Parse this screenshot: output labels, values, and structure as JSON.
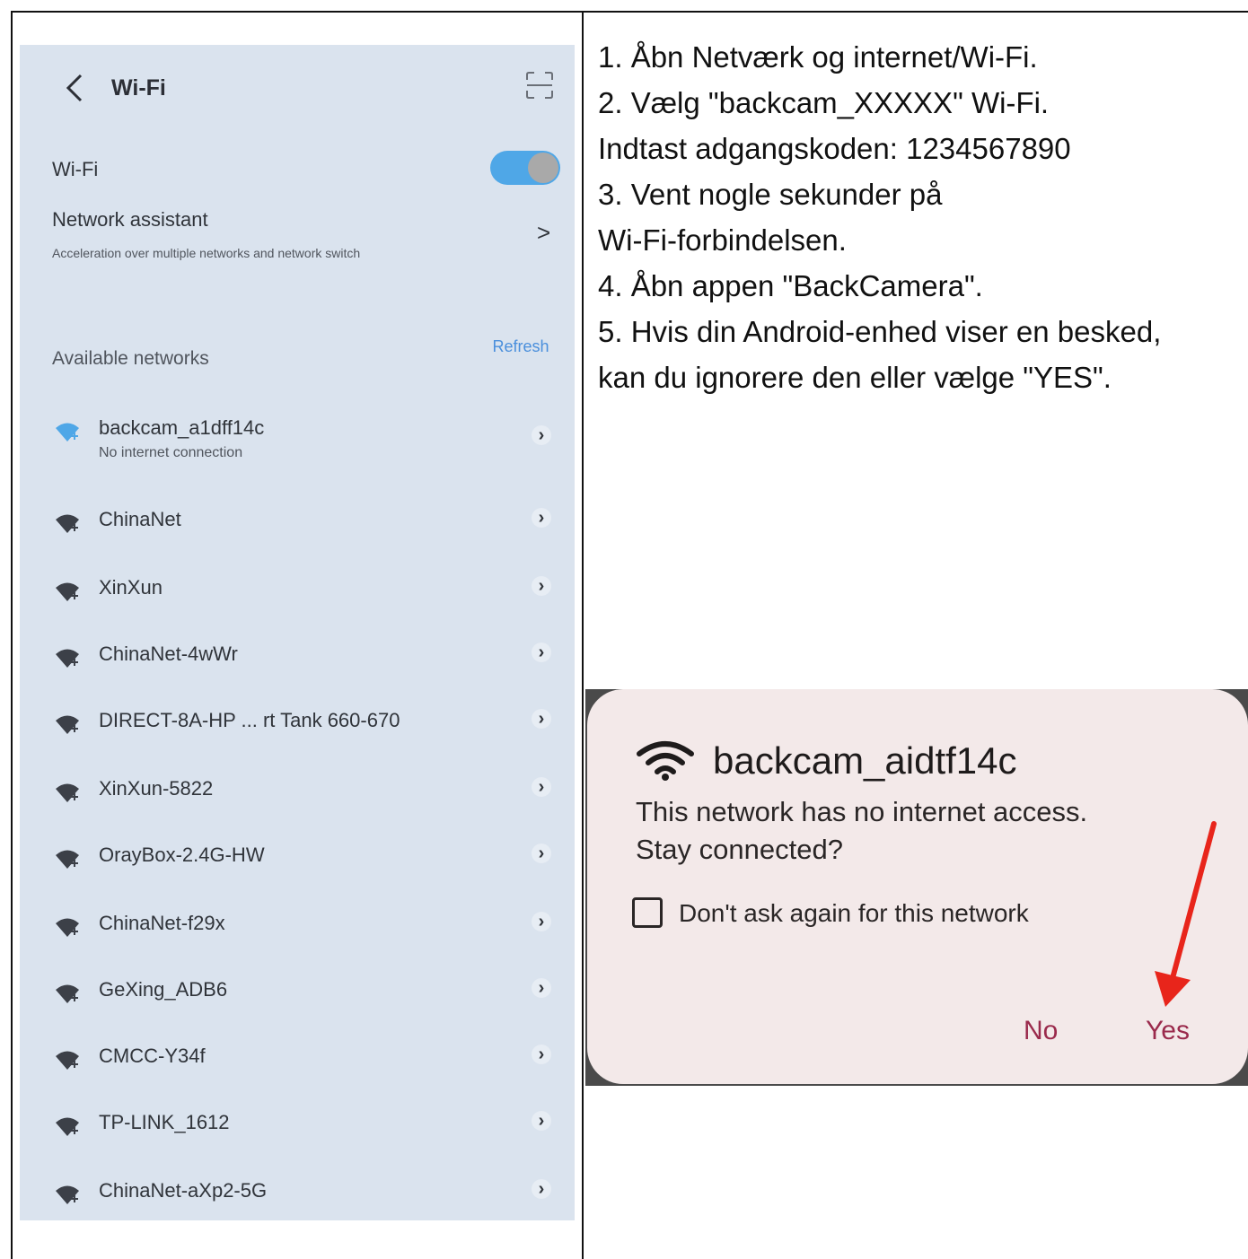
{
  "phone": {
    "title": "Wi-Fi",
    "wifi_label": "Wi-Fi",
    "wifi_enabled": true,
    "assistant_title": "Network assistant",
    "assistant_subtitle": "Acceleration over multiple networks and network switch",
    "available_label": "Available networks",
    "refresh_label": "Refresh",
    "networks": [
      {
        "name": "backcam_a1dff14c",
        "status": "No internet connection",
        "connected": true
      },
      {
        "name": "ChinaNet"
      },
      {
        "name": "XinXun"
      },
      {
        "name": "ChinaNet-4wWr"
      },
      {
        "name": "DIRECT-8A-HP ... rt Tank 660-670"
      },
      {
        "name": "XinXun-5822"
      },
      {
        "name": "OrayBox-2.4G-HW"
      },
      {
        "name": "ChinaNet-f29x"
      },
      {
        "name": "GeXing_ADB6"
      },
      {
        "name": "CMCC-Y34f"
      },
      {
        "name": "TP-LINK_1612"
      },
      {
        "name": "ChinaNet-aXp2-5G"
      }
    ]
  },
  "instructions": [
    "1. Åbn Netværk og internet/Wi-Fi.",
    "2. Vælg \"backcam_XXXXX\" Wi-Fi.",
    "Indtast adgangskoden: 1234567890",
    "3. Vent nogle sekunder på",
    "Wi-Fi-forbindelsen.",
    "4. Åbn appen \"BackCamera\".",
    "5. Hvis din Android-enhed viser en besked,",
    "kan du ignorere den eller vælge \"YES\"."
  ],
  "dialog": {
    "title": "backcam_aidtf14c",
    "message_line1": "This network has no internet access.",
    "message_line2": "Stay connected?",
    "checkbox_label": "Don't ask again for this network",
    "checkbox_checked": false,
    "no_label": "No",
    "yes_label": "Yes",
    "accent_color": "#9a2a4c",
    "arrow_color": "#e8251b"
  }
}
